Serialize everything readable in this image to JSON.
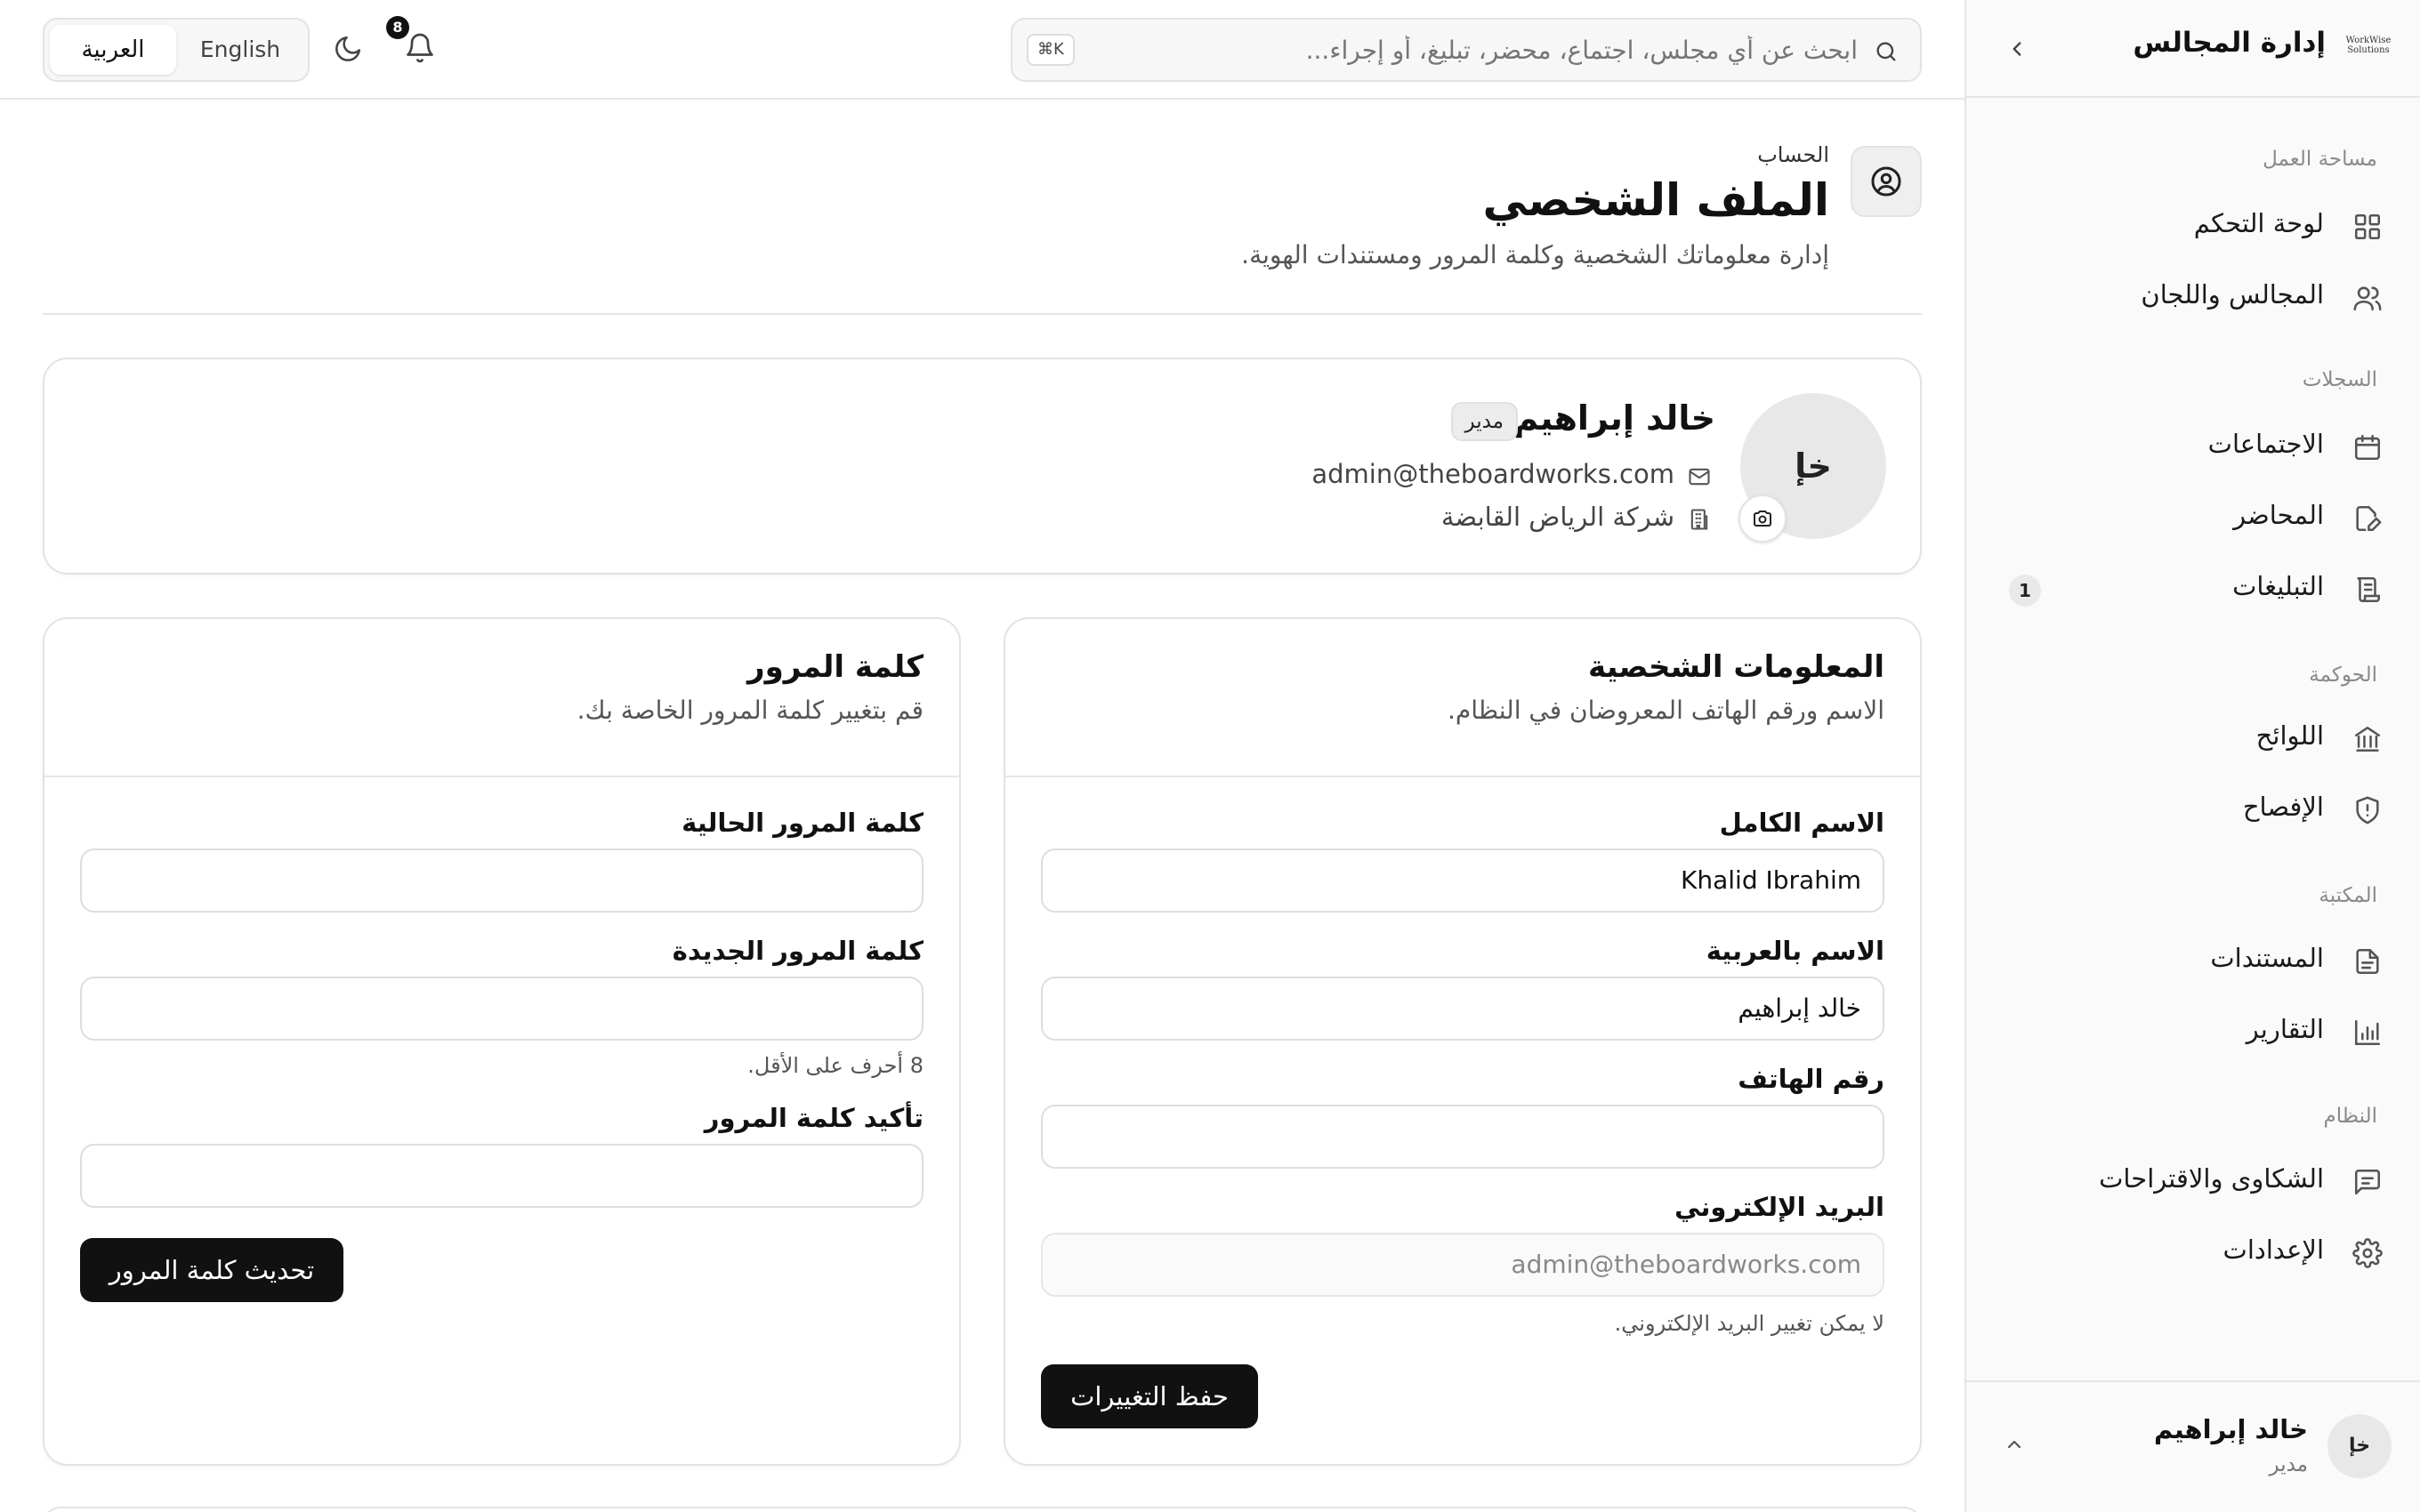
{
  "brand": {
    "logo_text": "WorkWise Solutions",
    "app_title": "إدارة المجالس"
  },
  "sidebar": {
    "groups": [
      {
        "label": "مساحة العمل",
        "items": [
          {
            "label": "لوحة التحكم",
            "icon": "dashboard-icon"
          },
          {
            "label": "المجالس واللجان",
            "icon": "users-icon"
          }
        ]
      },
      {
        "label": "السجلات",
        "items": [
          {
            "label": "الاجتماعات",
            "icon": "calendar-icon"
          },
          {
            "label": "المحاضر",
            "icon": "minutes-edit-icon"
          },
          {
            "label": "التبليغات",
            "icon": "scroll-icon",
            "badge": "1"
          }
        ]
      },
      {
        "label": "الحوكمة",
        "items": [
          {
            "label": "اللوائح",
            "icon": "landmark-icon"
          },
          {
            "label": "الإفصاح",
            "icon": "shield-alert-icon"
          }
        ]
      },
      {
        "label": "المكتبة",
        "items": [
          {
            "label": "المستندات",
            "icon": "file-text-icon"
          },
          {
            "label": "التقارير",
            "icon": "bar-chart-icon"
          }
        ]
      },
      {
        "label": "النظام",
        "items": [
          {
            "label": "الشكاوى والاقتراحات",
            "icon": "message-icon"
          },
          {
            "label": "الإعدادات",
            "icon": "settings-icon"
          }
        ]
      }
    ],
    "user": {
      "initials": "خإ",
      "name": "خالد إبراهيم",
      "role": "مدير"
    }
  },
  "topbar": {
    "search_placeholder": "ابحث عن أي مجلس، اجتماع، محضر، تبليغ، أو إجراء...",
    "search_shortcut": "⌘K",
    "notification_count": "8",
    "lang_options": [
      "العربية",
      "English"
    ],
    "lang_selected": "العربية"
  },
  "page": {
    "breadcrumb": "الحساب",
    "title": "الملف الشخصي",
    "subtitle": "إدارة معلوماتك الشخصية وكلمة المرور ومستندات الهوية."
  },
  "profile": {
    "initials": "خإ",
    "name": "خالد إبراهيم",
    "role_badge": "مدير",
    "email": "admin@theboardworks.com",
    "company": "شركة الرياض القابضة"
  },
  "personal_info": {
    "title": "المعلومات الشخصية",
    "subtitle": "الاسم ورقم الهاتف المعروضان في النظام.",
    "full_name_label": "الاسم الكامل",
    "full_name_value": "Khalid Ibrahim",
    "arabic_name_label": "الاسم بالعربية",
    "arabic_name_value": "خالد إبراهيم",
    "phone_label": "رقم الهاتف",
    "phone_value": "",
    "email_label": "البريد الإلكتروني",
    "email_value": "admin@theboardworks.com",
    "email_hint": "لا يمكن تغيير البريد الإلكتروني.",
    "save_label": "حفظ التغييرات"
  },
  "password": {
    "title": "كلمة المرور",
    "subtitle": "قم بتغيير كلمة المرور الخاصة بك.",
    "current_label": "كلمة المرور الحالية",
    "new_label": "كلمة المرور الجديدة",
    "new_hint": "8 أحرف على الأقل.",
    "confirm_label": "تأكيد كلمة المرور",
    "update_label": "تحديث كلمة المرور"
  }
}
